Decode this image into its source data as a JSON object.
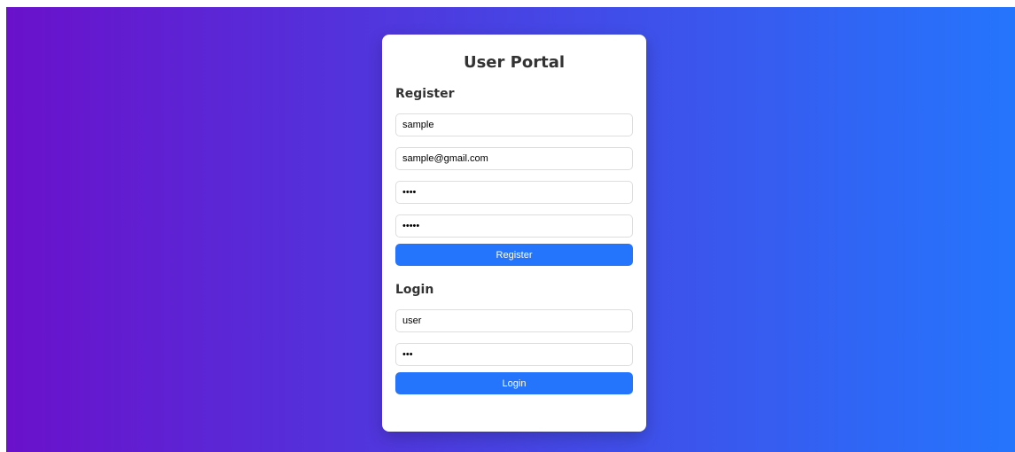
{
  "portal": {
    "title": "User Portal"
  },
  "register": {
    "heading": "Register",
    "username_value": "sample",
    "email_value": "sample@gmail.com",
    "password_value": "1234",
    "confirm_password_value": "12345",
    "button_label": "Register"
  },
  "login": {
    "heading": "Login",
    "username_value": "user",
    "password_value": "123",
    "button_label": "Login"
  },
  "colors": {
    "gradient_start": "#6a11cb",
    "gradient_end": "#2575fc",
    "button": "#2575fc"
  }
}
